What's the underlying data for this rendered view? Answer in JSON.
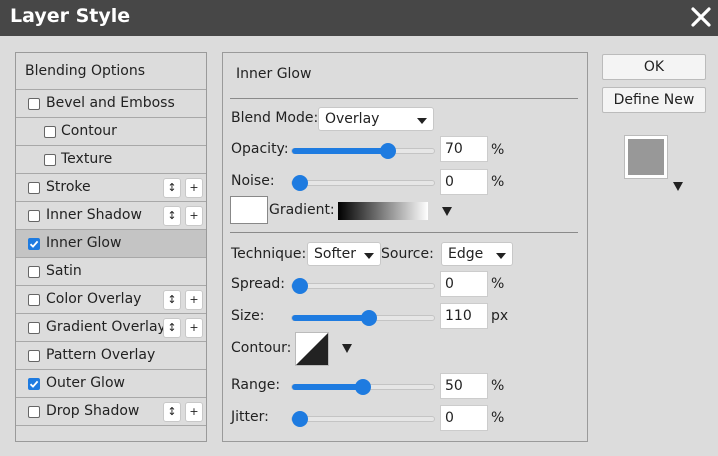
{
  "window": {
    "title": "Layer Style"
  },
  "left_list": {
    "header": "Blending Options",
    "items": [
      {
        "label": "Bevel and Emboss",
        "checked": false
      },
      {
        "label": "Contour",
        "checked": false
      },
      {
        "label": "Texture",
        "checked": false
      },
      {
        "label": "Stroke",
        "checked": false
      },
      {
        "label": "Inner Shadow",
        "checked": false
      },
      {
        "label": "Inner Glow",
        "checked": true
      },
      {
        "label": "Satin",
        "checked": false
      },
      {
        "label": "Color Overlay",
        "checked": false
      },
      {
        "label": "Gradient Overlay",
        "checked": false
      },
      {
        "label": "Pattern Overlay",
        "checked": false
      },
      {
        "label": "Outer Glow",
        "checked": true
      },
      {
        "label": "Drop Shadow",
        "checked": false
      }
    ],
    "stepper_up": "↕",
    "add_label": "+"
  },
  "panel": {
    "title": "Inner Glow",
    "blend_mode": {
      "label": "Blend Mode:",
      "value": "Overlay"
    },
    "opacity": {
      "label": "Opacity:",
      "value": "70",
      "unit": "%",
      "fraction": 0.7
    },
    "noise": {
      "label": "Noise:",
      "value": "0",
      "unit": "%",
      "fraction": 0
    },
    "gradient": {
      "label": "Gradient:"
    },
    "technique": {
      "label": "Technique:",
      "value": "Softer"
    },
    "source": {
      "label": "Source:",
      "value": "Edge"
    },
    "spread": {
      "label": "Spread:",
      "value": "0",
      "unit": "%",
      "fraction": 0
    },
    "size": {
      "label": "Size:",
      "value": "110",
      "unit": "px",
      "fraction": 0.55
    },
    "contour": {
      "label": "Contour:"
    },
    "range": {
      "label": "Range:",
      "value": "50",
      "unit": "%",
      "fraction": 0.5
    },
    "jitter": {
      "label": "Jitter:",
      "value": "0",
      "unit": "%",
      "fraction": 0
    }
  },
  "buttons": {
    "ok": "OK",
    "define_new": "Define New"
  },
  "colors": {
    "accent": "#1e7be0",
    "preview_swatch": "#989898"
  }
}
